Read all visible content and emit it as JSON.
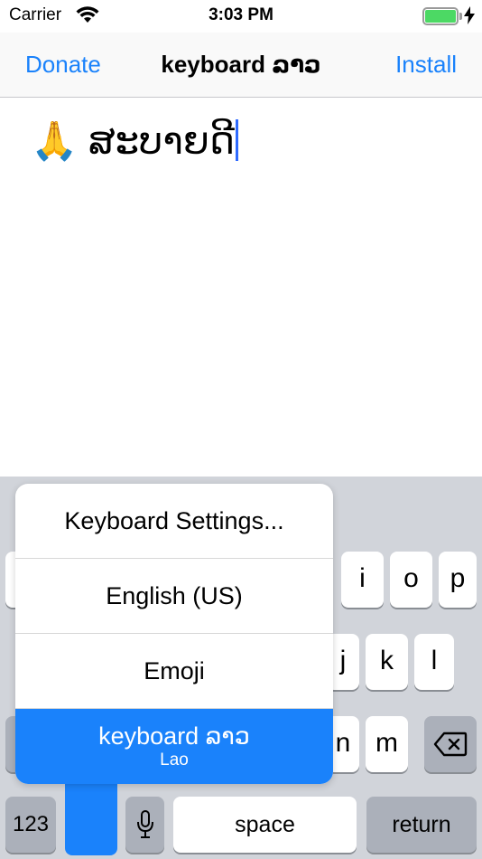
{
  "status_bar": {
    "carrier": "Carrier",
    "time": "3:03 PM",
    "icons": [
      "wifi-icon",
      "battery-icon",
      "charging-bolt-icon"
    ],
    "battery_color": "#4cd964"
  },
  "nav_bar": {
    "left_button": "Donate",
    "title": "keyboard ລາວ",
    "right_button": "Install",
    "accent_color": "#1a82fb"
  },
  "text_area": {
    "content": "🙏 ສະບາຍດີ"
  },
  "keyboard": {
    "row1": [
      "i",
      "o",
      "p"
    ],
    "row2": [
      "j",
      "k",
      "l"
    ],
    "row3": [
      "n",
      "m"
    ],
    "bottom": {
      "numbers_label": "123",
      "space_label": "space",
      "return_label": "return"
    },
    "icons": [
      "backspace-icon",
      "microphone-icon"
    ]
  },
  "input_switcher": {
    "items": [
      {
        "label": "Keyboard Settings..."
      },
      {
        "label": "English (US)"
      },
      {
        "label": "Emoji"
      },
      {
        "label": "keyboard ລາວ",
        "sublabel": "Lao",
        "selected": true
      }
    ],
    "selected_color": "#1a82fb"
  }
}
